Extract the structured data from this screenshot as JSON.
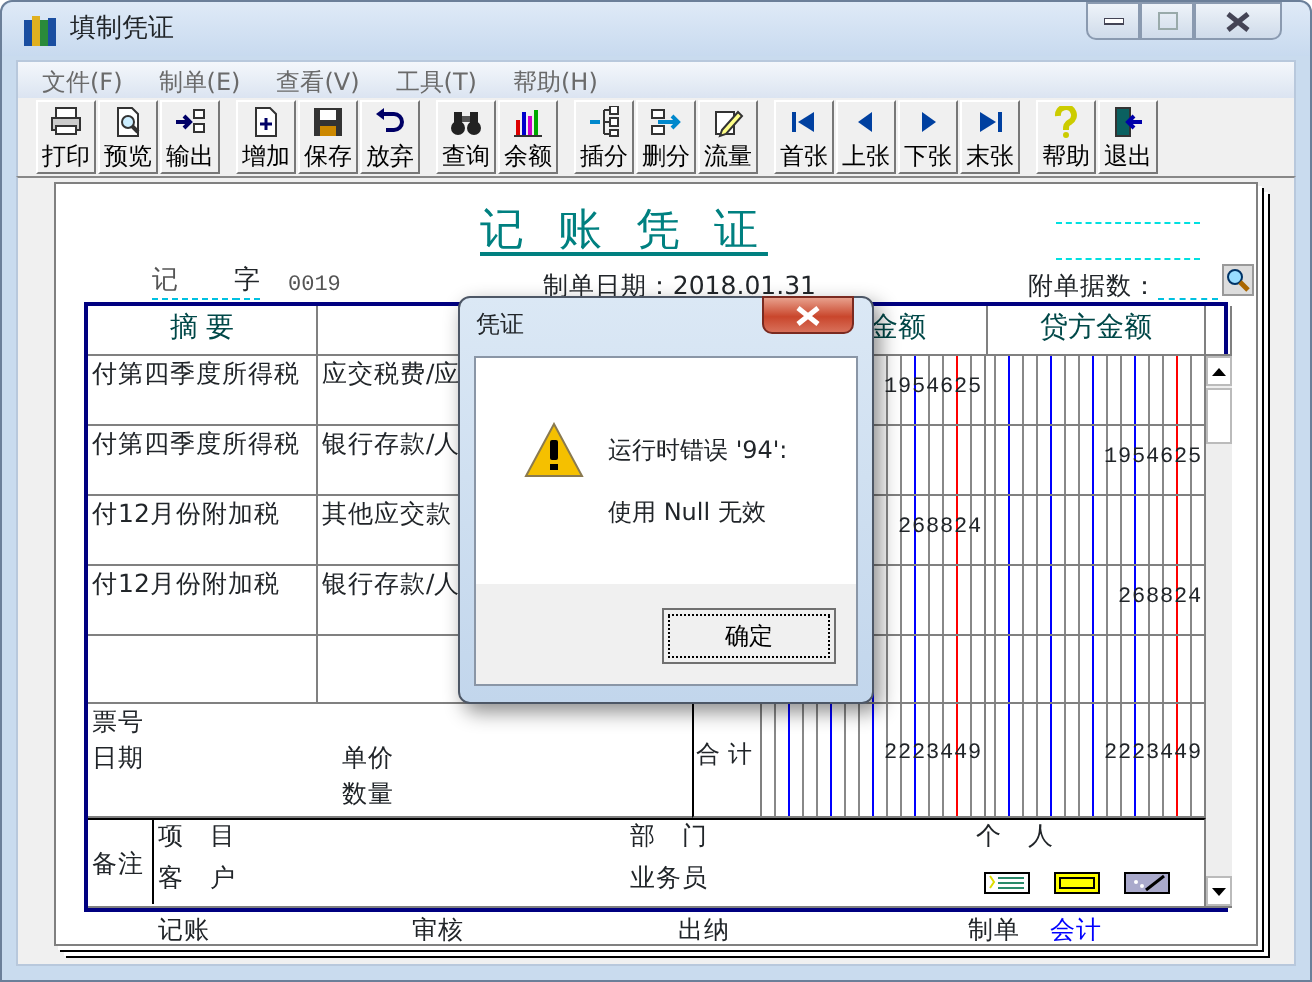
{
  "window": {
    "title": "填制凭证"
  },
  "menu": [
    {
      "label": "文件(F)"
    },
    {
      "label": "制单(E)"
    },
    {
      "label": "查看(V)"
    },
    {
      "label": "工具(T)"
    },
    {
      "label": "帮助(H)"
    }
  ],
  "toolbar": [
    [
      {
        "label": "打印"
      },
      {
        "label": "预览"
      },
      {
        "label": "输出"
      }
    ],
    [
      {
        "label": "增加"
      },
      {
        "label": "保存"
      },
      {
        "label": "放弃"
      }
    ],
    [
      {
        "label": "查询"
      },
      {
        "label": "余额"
      }
    ],
    [
      {
        "label": "插分"
      },
      {
        "label": "删分"
      },
      {
        "label": "流量"
      }
    ],
    [
      {
        "label": "首张"
      },
      {
        "label": "上张"
      },
      {
        "label": "下张"
      },
      {
        "label": "末张"
      }
    ],
    [
      {
        "label": "帮助"
      },
      {
        "label": "退出"
      }
    ]
  ],
  "voucher": {
    "title": "记 账 凭 证",
    "type": "记",
    "type_suffix": "字",
    "number": "0019",
    "date": "制单日期：2018.01.31",
    "attachments_label": "附单据数：",
    "summary_header": "摘 要",
    "debit_header": "金额",
    "credit_header": "贷方金额",
    "rows": [
      {
        "summary": "付第四季度所得税",
        "account": "应交税费/应",
        "debit": "1954625"
      },
      {
        "summary": "付第四季度所得税",
        "account": "银行存款/人",
        "credit": "1954625"
      },
      {
        "summary": "付12月份附加税",
        "account": "其他应交款",
        "debit": "268824"
      },
      {
        "summary": "付12月份附加税",
        "account": "银行存款/人",
        "credit": "268824"
      },
      {}
    ],
    "ticket_label": "票号",
    "date_label": "日期",
    "unit_price_label": "单价",
    "quantity_label": "数量",
    "total_label": "合 计",
    "debit_total": "2223449",
    "credit_total": "2223449",
    "remarks_label": "备注",
    "project_label": "项　目",
    "customer_label": "客　户",
    "department_label": "部　门",
    "salesperson_label": "业务员",
    "person_label": "个　人",
    "signatures": [
      {
        "label": "记账"
      },
      {
        "label": "审核"
      },
      {
        "label": "出纳"
      },
      {
        "label": "制单"
      }
    ],
    "preparer": "会计"
  },
  "dialog": {
    "title": "凭证",
    "messages": [
      "运行时错误 '94':",
      "使用 Null 无效"
    ],
    "buttons": [
      {
        "label": "确定",
        "focused": true
      }
    ]
  }
}
